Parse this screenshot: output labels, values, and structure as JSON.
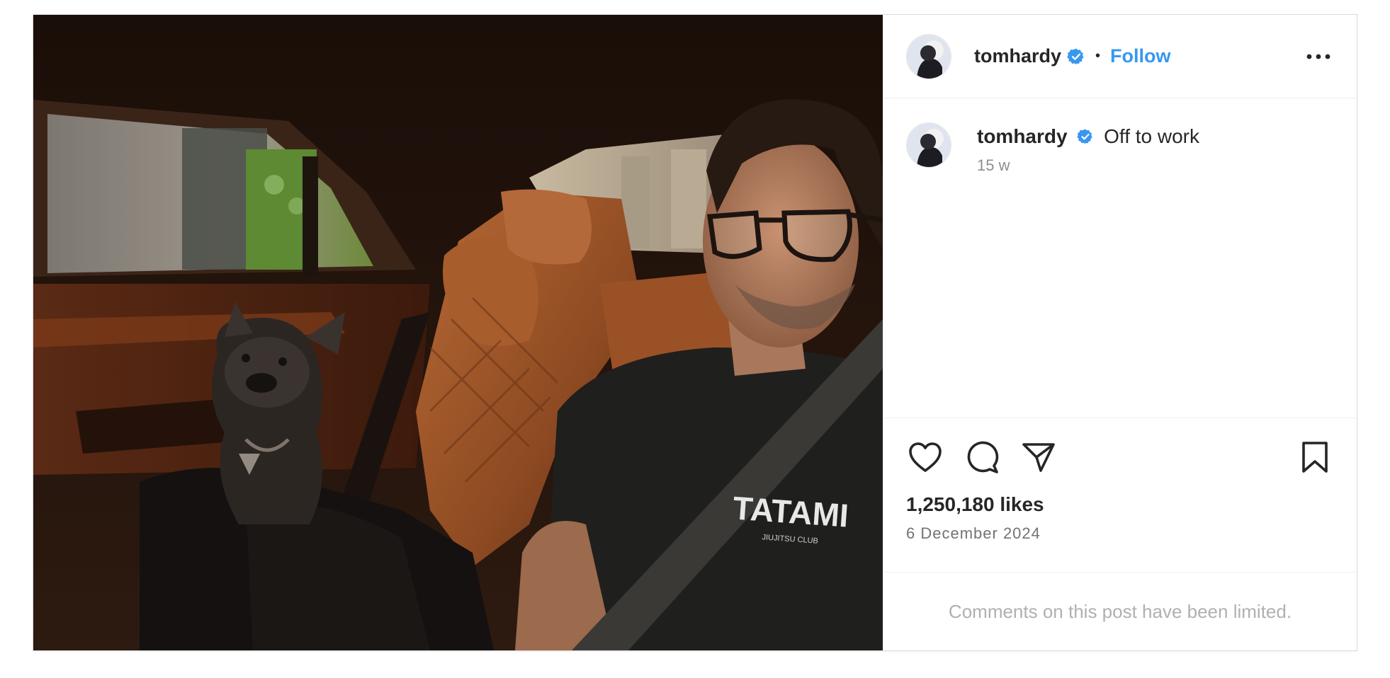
{
  "post": {
    "username": "tomhardy",
    "follow_label": "Follow",
    "separator": "•",
    "caption_text": "Off to work",
    "caption_time": "15 w",
    "likes": "1,250,180 likes",
    "date": "6 December 2024",
    "comments_notice": "Comments on this post have been limited.",
    "image_print": {
      "shirt_brand": "TATAMI",
      "shirt_sub": "JIUJITSU CLUB"
    }
  },
  "icons": {
    "verified": "verified-badge-icon",
    "more": "more-options-icon",
    "like": "heart-icon",
    "comment": "comment-icon",
    "share": "share-icon",
    "save": "bookmark-icon"
  },
  "colors": {
    "accent": "#3897f0",
    "verified": "#3897f0",
    "muted": "#8e8e8e",
    "border": "#dbdbdb"
  }
}
